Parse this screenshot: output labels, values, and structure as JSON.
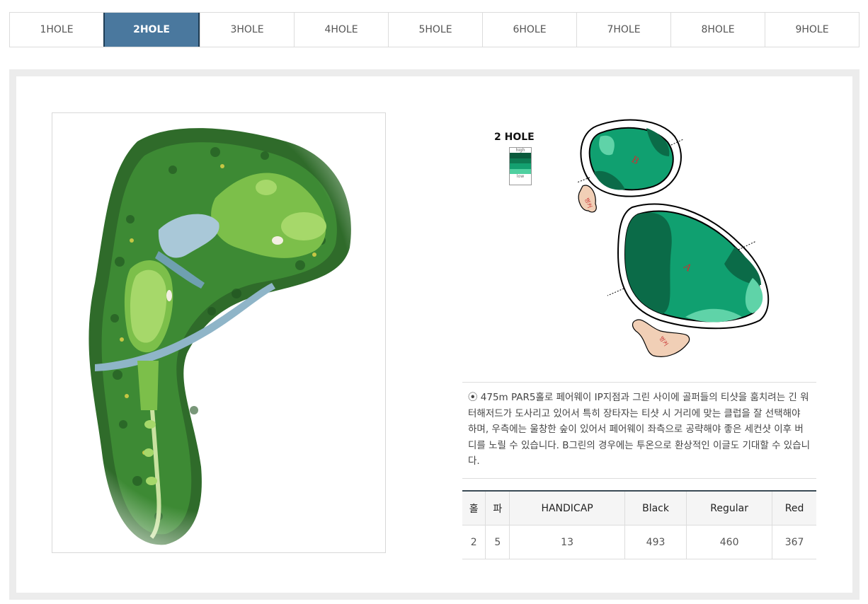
{
  "tabs": [
    "1HOLE",
    "2HOLE",
    "3HOLE",
    "4HOLE",
    "5HOLE",
    "6HOLE",
    "7HOLE",
    "8HOLE",
    "9HOLE"
  ],
  "active_tab": "2HOLE",
  "green_title": "2 HOLE",
  "scale": {
    "high": "high",
    "low": "low"
  },
  "greens": {
    "b_label": "B",
    "a_label": "A",
    "bunker_label": "벙커"
  },
  "description": "⦿ 475m PAR5홀로 페어웨이 IP지점과 그린 사이에 골퍼들의 티샷을 훔치려는 긴 워터해저드가 도사리고 있어서 특히 장타자는 티샷 시 거리에 맞는 클럽을 잘 선택해야 하며, 우측에는 울창한 숲이 있어서 페어웨이 좌측으로 공략해야 좋은 세컨샷 이후 버디를 노릴 수 있습니다. B그린의 경우에는 투온으로 환상적인 이글도 기대할 수 있습니다.",
  "table": {
    "headers": [
      "홀",
      "파",
      "HANDICAP",
      "Black",
      "Regular",
      "Red"
    ],
    "row": [
      "2",
      "5",
      "13",
      "493",
      "460",
      "367"
    ]
  },
  "colors": {
    "active_tab": "#4a789e",
    "green_dark": "#0b6b48",
    "green_mid": "#10a070",
    "green_light": "#5fd3a8",
    "bunker": "#f1cfb6"
  }
}
